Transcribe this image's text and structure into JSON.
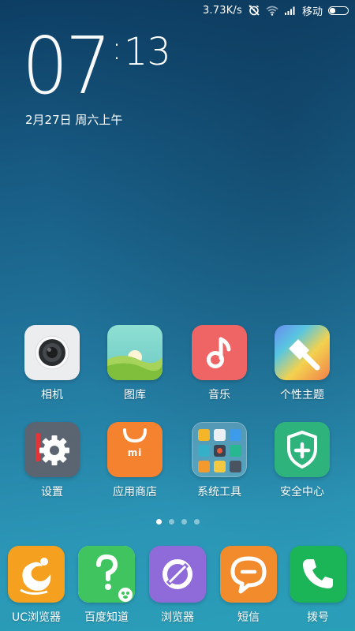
{
  "status_bar": {
    "network_speed": "3.73K/s",
    "carrier": "移动",
    "icons": [
      "alarm-off-icon",
      "wifi-icon",
      "signal-icon",
      "battery-icon"
    ]
  },
  "clock": {
    "hour": "07",
    "colon": ":",
    "minute": "13",
    "date": "2月27日 周六上午"
  },
  "apps": {
    "row1": [
      {
        "label": "相机",
        "icon": "camera-icon"
      },
      {
        "label": "图库",
        "icon": "gallery-icon"
      },
      {
        "label": "音乐",
        "icon": "music-icon"
      },
      {
        "label": "个性主题",
        "icon": "theme-brush-icon"
      }
    ],
    "row2": [
      {
        "label": "设置",
        "icon": "settings-gear-icon"
      },
      {
        "label": "应用商店",
        "icon": "app-store-bag-icon",
        "badge": "mi"
      },
      {
        "label": "系统工具",
        "icon": "folder-icon"
      },
      {
        "label": "安全中心",
        "icon": "shield-icon"
      }
    ]
  },
  "page_indicator": {
    "count": 4,
    "active": 0
  },
  "dock": [
    {
      "label": "UC浏览器",
      "icon": "uc-browser-icon"
    },
    {
      "label": "百度知道",
      "icon": "baidu-zhidao-icon"
    },
    {
      "label": "浏览器",
      "icon": "browser-icon"
    },
    {
      "label": "短信",
      "icon": "sms-icon"
    },
    {
      "label": "拨号",
      "icon": "phone-icon"
    }
  ],
  "colors": {
    "camera_bg": "#ecedef",
    "gallery_bg": "#7ed3c9",
    "music_bg": "#ef6464",
    "settings_bg": "#5b6572",
    "store_bg": "#f5822e",
    "security_bg": "#2fb37c",
    "uc_bg": "#f5a01e",
    "baidu_bg": "#3fc45f",
    "browser_bg": "#8e6bd9",
    "sms_bg": "#f28b2c",
    "phone_bg": "#1bb457"
  }
}
